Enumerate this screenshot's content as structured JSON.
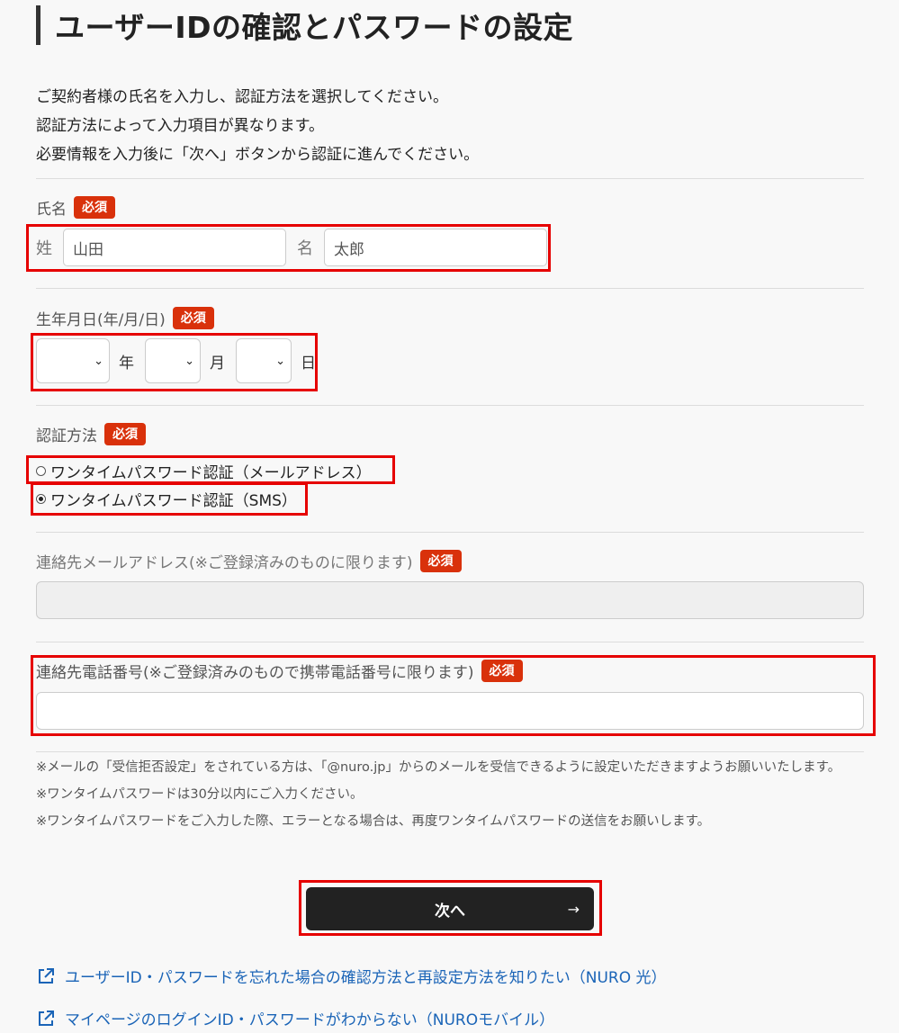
{
  "page": {
    "title": "ユーザーIDの確認とパスワードの設定",
    "intro": [
      "ご契約者様の氏名を入力し、認証方法を選択してください。",
      "認証方法によって入力項目が異なります。",
      "必要情報を入力後に「次へ」ボタンから認証に進んでください。"
    ]
  },
  "required_badge": "必須",
  "name": {
    "label": "氏名",
    "last_label": "姓",
    "last_value": "山田",
    "first_label": "名",
    "first_value": "太郎"
  },
  "dob": {
    "label": "生年月日(年/月/日)",
    "year_unit": "年",
    "month_unit": "月",
    "day_unit": "日"
  },
  "auth": {
    "label": "認証方法",
    "options": [
      {
        "label": "ワンタイムパスワード認証（メールアドレス）",
        "selected": false
      },
      {
        "label": "ワンタイムパスワード認証（SMS）",
        "selected": true
      }
    ]
  },
  "email": {
    "label": "連絡先メールアドレス(※ご登録済みのものに限ります)",
    "value": ""
  },
  "phone": {
    "label": "連絡先電話番号(※ご登録済みのもので携帯電話番号に限ります)",
    "value": ""
  },
  "notes": [
    "※メールの「受信拒否設定」をされている方は、「@nuro.jp」からのメールを受信できるように設定いただきますようお願いいたします。",
    "※ワンタイムパスワードは30分以内にご入力ください。",
    "※ワンタイムパスワードをご入力した際、エラーとなる場合は、再度ワンタイムパスワードの送信をお願いします。"
  ],
  "next_button": {
    "label": "次へ",
    "arrow": "→"
  },
  "links": [
    {
      "label": "ユーザーID・パスワードを忘れた場合の確認方法と再設定方法を知りたい（NURO 光）"
    },
    {
      "label": "マイページのログインID・パスワードがわからない（NUROモバイル）"
    }
  ],
  "colors": {
    "required_badge": "#d9310b",
    "highlight_box": "#e60000",
    "button_bg": "#222222",
    "link": "#1a64b7"
  },
  "icons": {
    "select_arrow": "chevron-down-icon",
    "next_arrow": "arrow-right-icon",
    "link_icon": "external-link-icon"
  }
}
